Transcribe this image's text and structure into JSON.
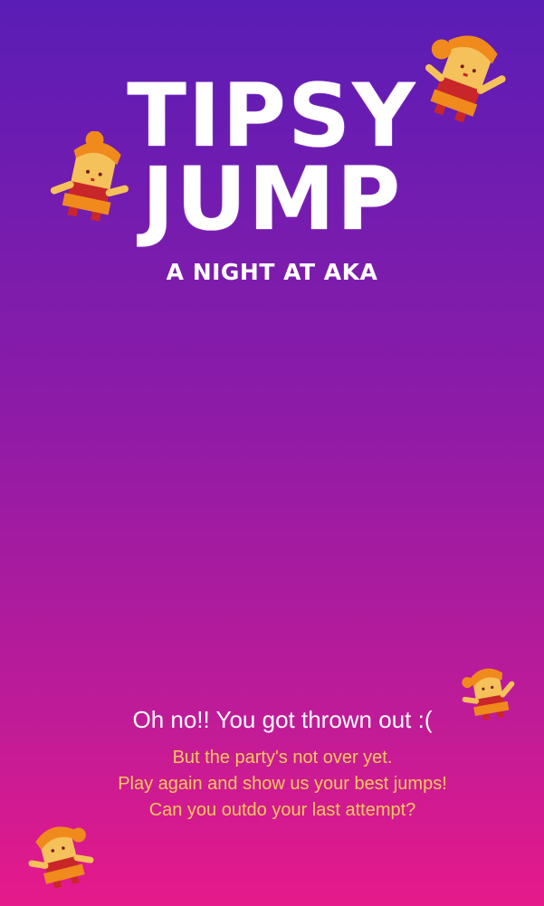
{
  "game": {
    "title_line1": "TIPSY",
    "title_line2": "JUMP",
    "subtitle": "A NIGHT AT AKA"
  },
  "game_over": {
    "heading": "Oh no!! You got thrown out :(",
    "lines": [
      "But the party's not over yet.",
      "Play again and show us your best jumps!",
      "Can you outdo your last attempt?"
    ]
  },
  "colors": {
    "bg_top": "#5a1db6",
    "bg_bottom": "#e61a8a",
    "title": "#ffffff",
    "message_accent": "#f6c85a",
    "character_skin": "#f5c15a",
    "character_hair": "#f08a1c",
    "character_dress": "#c9262a"
  },
  "decorations": [
    "jumping-girl-character",
    "jumping-girl-character",
    "jumping-girl-character",
    "jumping-girl-character"
  ]
}
